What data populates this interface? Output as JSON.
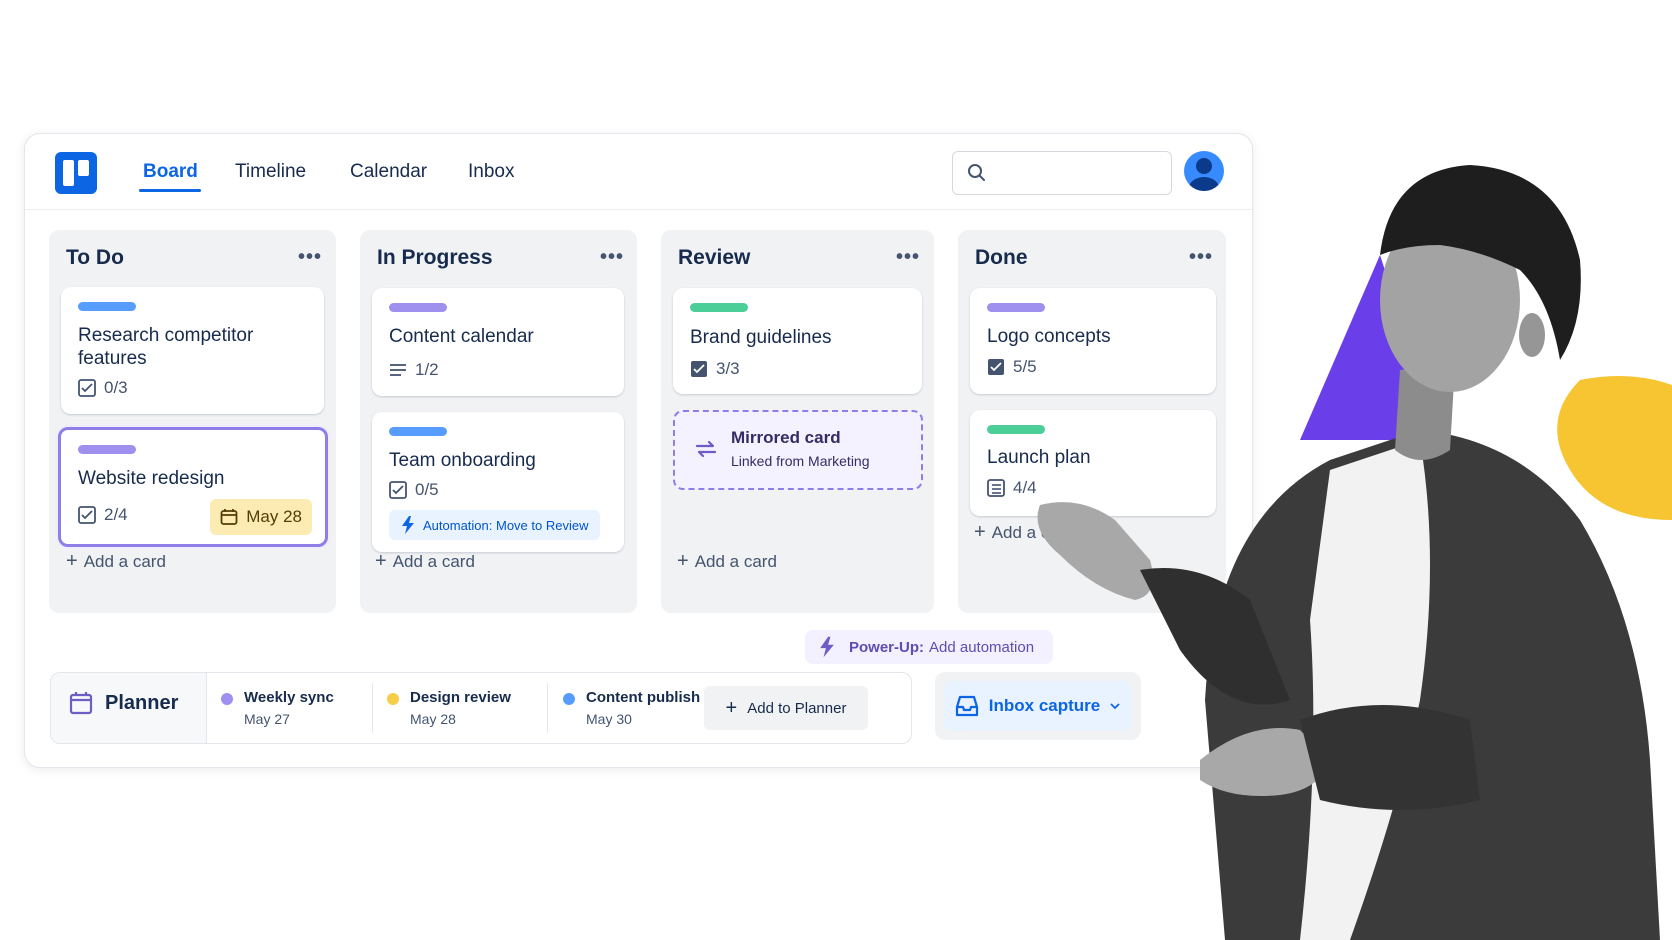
{
  "nav": {
    "tabs": [
      {
        "label": "Board",
        "active": true
      },
      {
        "label": "Timeline",
        "active": false
      },
      {
        "label": "Calendar",
        "active": false
      },
      {
        "label": "Inbox",
        "active": false
      }
    ],
    "search": {
      "placeholder": ""
    }
  },
  "lists": [
    {
      "title": "To Do",
      "menu": "•••",
      "add_card": "Add a card",
      "cards": [
        {
          "label_color": "#579dff",
          "title_line1": "Research competitor",
          "title_line2": "features",
          "checklist": "0/3"
        },
        {
          "label_color": "#9f8fef",
          "title": "Website redesign",
          "checklist": "2/4",
          "due": "May 28",
          "highlighted": true
        }
      ]
    },
    {
      "title": "In Progress",
      "menu": "•••",
      "add_card": "Add a card",
      "cards": [
        {
          "label_color": "#9f8fef",
          "title": "Content calendar",
          "description_count": "1/2"
        },
        {
          "label_color": "#579dff",
          "title": "Team onboarding",
          "checklist": "0/5",
          "automation": "Automation: Move to Review"
        }
      ]
    },
    {
      "title": "Review",
      "menu": "•••",
      "add_card": "Add a card",
      "cards": [
        {
          "label_color": "#4bce97",
          "title": "Brand guidelines",
          "checklist": "3/3"
        },
        {
          "mirrored": true,
          "title": "Mirrored card",
          "subtitle": "Linked from Marketing"
        }
      ]
    },
    {
      "title": "Done",
      "menu": "•••",
      "add_card": "Add a ca",
      "cards": [
        {
          "label_color": "#9f8fef",
          "title": "Logo concepts",
          "checklist": "5/5"
        },
        {
          "label_color": "#4bce97",
          "title": "Launch plan",
          "checklist": "4/4"
        }
      ]
    }
  ],
  "powerup": {
    "prefix": "Power-Up:",
    "text": "Add automation"
  },
  "planner": {
    "title": "Planner",
    "events": [
      {
        "title": "Weekly sync",
        "date": "May 27",
        "color": "#9f8fef"
      },
      {
        "title": "Design review",
        "date": "May 28",
        "color": "#f5cd47"
      },
      {
        "title": "Content publish",
        "date": "May 30",
        "color": "#579dff"
      }
    ],
    "add_button": "Add to Planner"
  },
  "inbox_capture": {
    "label": "Inbox capture"
  },
  "colors": {
    "accent": "#0c66e4",
    "purple": "#6e5dc6",
    "yellow": "#f5c431"
  }
}
